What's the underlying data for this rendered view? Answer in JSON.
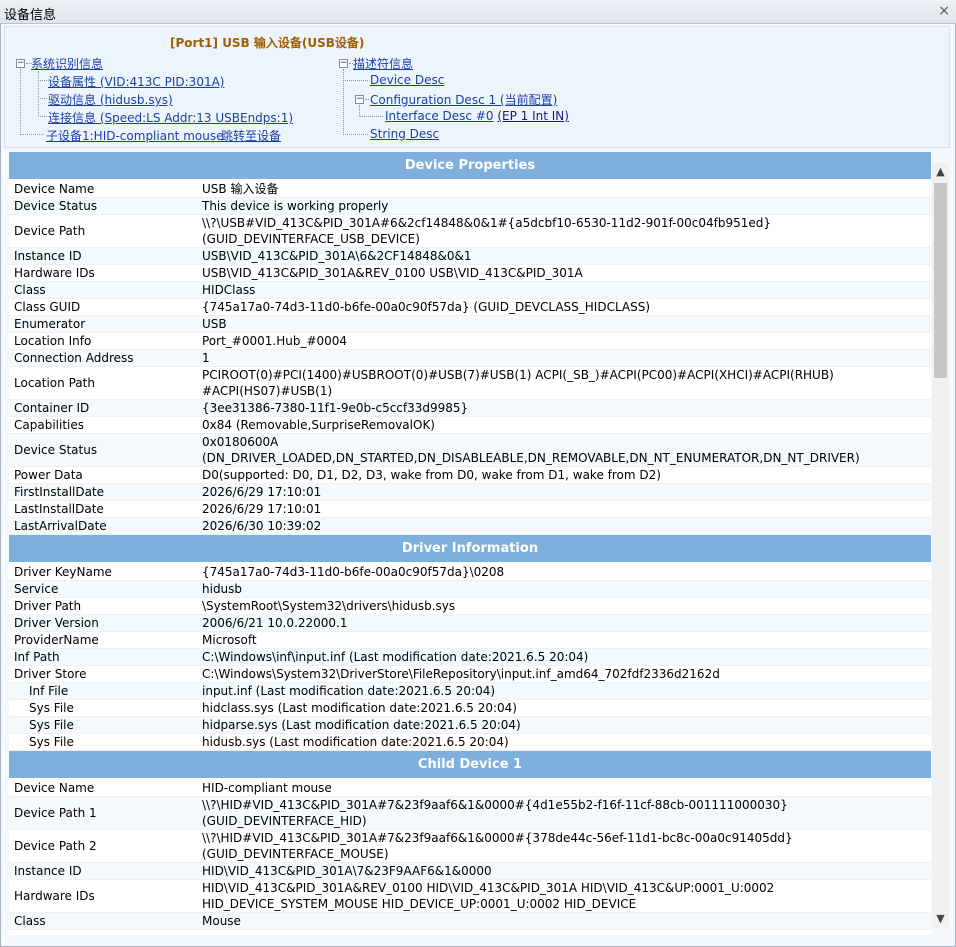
{
  "window": {
    "title": "设备信息",
    "close": "×"
  },
  "tree": {
    "port_title": "[Port1] USB 输入设备(USB设备)",
    "left": {
      "root": "系统识别信息",
      "items": [
        "设备属性 (VID:413C PID:301A)",
        "驱动信息 (hidusb.sys)",
        "连接信息 (Speed:LS Addr:13 USBEndps:1)"
      ],
      "child": "子设备1:HID-compliant mouse",
      "jump": "跳转至设备"
    },
    "right": {
      "root": "描述符信息",
      "device_desc": "Device Desc",
      "config_desc": "Configuration Desc 1 (当前配置)",
      "interface_desc": "Interface Desc #0",
      "interface_ep": "(EP 1 Int IN)",
      "string_desc": "String Desc"
    }
  },
  "sections": {
    "device": {
      "title": "Device Properties",
      "rows": [
        [
          "Device Name",
          "USB 输入设备"
        ],
        [
          "Device Status",
          "This device is working properly"
        ],
        [
          "Device Path",
          "\\\\?\\USB#VID_413C&PID_301A#6&2cf14848&0&1#{a5dcbf10-6530-11d2-901f-00c04fb951ed}",
          "(GUID_DEVINTERFACE_USB_DEVICE)"
        ],
        [
          "Instance ID",
          "USB\\VID_413C&PID_301A\\6&2CF14848&0&1"
        ],
        [
          "Hardware IDs",
          "USB\\VID_413C&PID_301A&REV_0100 USB\\VID_413C&PID_301A"
        ],
        [
          "Class",
          "HIDClass"
        ],
        [
          "Class GUID",
          "{745a17a0-74d3-11d0-b6fe-00a0c90f57da} (GUID_DEVCLASS_HIDCLASS)"
        ],
        [
          "Enumerator",
          "USB"
        ],
        [
          "Location Info",
          "Port_#0001.Hub_#0004"
        ],
        [
          "Connection Address",
          "1"
        ],
        [
          "Location Path",
          "PCIROOT(0)#PCI(1400)#USBROOT(0)#USB(7)#USB(1) ACPI(_SB_)#ACPI(PC00)#ACPI(XHCI)#ACPI(RHUB)",
          "#ACPI(HS07)#USB(1)"
        ],
        [
          "Container ID",
          "{3ee31386-7380-11f1-9e0b-c5ccf33d9985}"
        ],
        [
          "Capabilities",
          "0x84 (Removable,SurpriseRemovalOK)"
        ],
        [
          "Device Status",
          "0x0180600A",
          "(DN_DRIVER_LOADED,DN_STARTED,DN_DISABLEABLE,DN_REMOVABLE,DN_NT_ENUMERATOR,DN_NT_DRIVER)"
        ],
        [
          "Power Data",
          "D0(supported: D0, D1, D2, D3, wake from D0, wake from D1, wake from D2)"
        ],
        [
          "FirstInstallDate",
          "2026/6/29 17:10:01"
        ],
        [
          "LastInstallDate",
          "2026/6/29 17:10:01"
        ],
        [
          "LastArrivalDate",
          "2026/6/30 10:39:02"
        ]
      ]
    },
    "driver": {
      "title": "Driver Information",
      "rows": [
        [
          "Driver KeyName",
          "{745a17a0-74d3-11d0-b6fe-00a0c90f57da}\\0208"
        ],
        [
          "Service",
          "hidusb"
        ],
        [
          "Driver Path",
          "\\SystemRoot\\System32\\drivers\\hidusb.sys"
        ],
        [
          "Driver Version",
          "2006/6/21 10.0.22000.1"
        ],
        [
          "ProviderName",
          "Microsoft"
        ],
        [
          "Inf Path",
          "C:\\Windows\\inf\\input.inf (Last modification date:2021.6.5 20:04)"
        ],
        [
          "Driver Store",
          "C:\\Windows\\System32\\DriverStore\\FileRepository\\input.inf_amd64_702fdf2336d2162d"
        ],
        [
          "Inf File",
          "input.inf (Last modification date:2021.6.5 20:04)",
          null,
          true
        ],
        [
          "Sys File",
          "hidclass.sys (Last modification date:2021.6.5 20:04)",
          null,
          true
        ],
        [
          "Sys File",
          "hidparse.sys (Last modification date:2021.6.5 20:04)",
          null,
          true
        ],
        [
          "Sys File",
          "hidusb.sys (Last modification date:2021.6.5 20:04)",
          null,
          true
        ]
      ]
    },
    "child": {
      "title": "Child Device 1",
      "rows": [
        [
          "Device Name",
          "HID-compliant mouse"
        ],
        [
          "Device Path 1",
          "\\\\?\\HID#VID_413C&PID_301A#7&23f9aaf6&1&0000#{4d1e55b2-f16f-11cf-88cb-001111000030}",
          "(GUID_DEVINTERFACE_HID)"
        ],
        [
          "Device Path 2",
          "\\\\?\\HID#VID_413C&PID_301A#7&23f9aaf6&1&0000#{378de44c-56ef-11d1-bc8c-00a0c91405dd}",
          "(GUID_DEVINTERFACE_MOUSE)"
        ],
        [
          "Instance ID",
          "HID\\VID_413C&PID_301A\\7&23F9AAF6&1&0000"
        ],
        [
          "Hardware IDs",
          "HID\\VID_413C&PID_301A&REV_0100 HID\\VID_413C&PID_301A HID\\VID_413C&UP:0001_U:0002",
          "HID_DEVICE_SYSTEM_MOUSE HID_DEVICE_UP:0001_U:0002 HID_DEVICE"
        ],
        [
          "Class",
          "Mouse"
        ]
      ]
    }
  },
  "scrollbar": {
    "up": "▲",
    "down": "▼"
  }
}
